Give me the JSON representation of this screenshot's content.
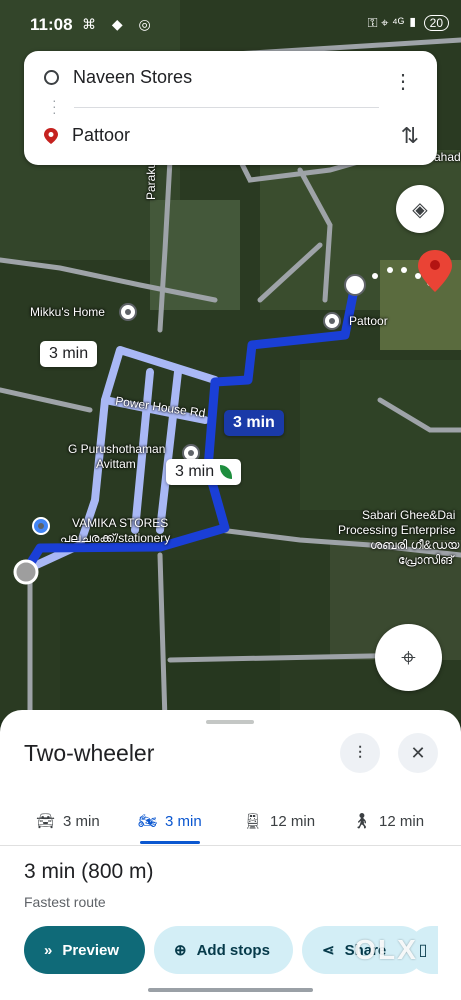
{
  "status_bar": {
    "time": "11:08",
    "left_icons": "⌘ ◆ ◎",
    "right_icons": "⚿ ⌖ ⁴ᴳ ▮",
    "battery": "20"
  },
  "search": {
    "origin": "Naveen Stores",
    "destination": "Pattoor",
    "more_icon": "more-vert-icon",
    "swap_icon": "swap-vert-icon"
  },
  "map": {
    "labels": {
      "parakudi_rd": "Parakudi Rd",
      "mikkus_home": "Mikku's Home",
      "pattoor": "Pattoor",
      "power_house_rd": "Power House Rd",
      "g_purushothaman": "G Purushothaman",
      "avittam": "Avittam",
      "vamika_stores": "VAMIKA STORES",
      "vamika_sub": "പലചരക്ക്/stationery",
      "sabari_ghee": "Sabari Ghee&Dai",
      "processing": "Processing Enterprise",
      "sabari_malayalam": "ശബരി ഗീ&ഡയ",
      "prosthin": "പ്രോസിങ്",
      "mahad": "ahad"
    },
    "bubbles": {
      "alt_route_1": "3 min",
      "primary_route": "3 min",
      "alt_route_2": "3 min"
    }
  },
  "sheet": {
    "mode_title": "Two-wheeler",
    "tabs": [
      {
        "icon": "car-icon",
        "label": "3 min"
      },
      {
        "icon": "motorcycle-icon",
        "label": "3 min"
      },
      {
        "icon": "transit-icon",
        "label": "12 min"
      },
      {
        "icon": "walk-icon",
        "label": "12 min"
      }
    ],
    "summary": "3 min (800 m)",
    "subtitle": "Fastest route",
    "actions": {
      "preview": "Preview",
      "add_stops": "Add stops",
      "share": "Share"
    },
    "watermark": "OLX"
  },
  "colors": {
    "route_primary": "#1a3fd6",
    "route_alt": "#a9b8f5",
    "preview_button": "#0f6a78",
    "pill_light": "#d3eef6",
    "destination_pin": "#ea4335"
  }
}
